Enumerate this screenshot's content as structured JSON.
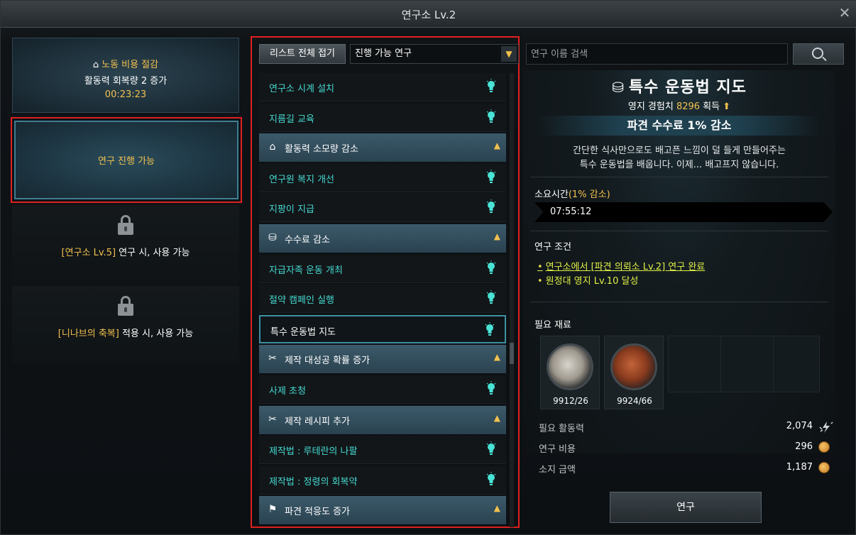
{
  "window": {
    "title": "연구소 Lv.2",
    "close_label": "✕"
  },
  "left": {
    "bonus": {
      "title": "노동 비용 절감",
      "desc": "활동력 회복량 2 증가",
      "time": "00:23:23"
    },
    "active_slot": {
      "label": "연구 진행 가능"
    },
    "locked_slots": [
      {
        "highlight": "[연구소 Lv.5]",
        "text": " 연구 시, 사용 가능"
      },
      {
        "highlight": "[니나브의 축복]",
        "text": " 적용 시, 사용 가능"
      }
    ]
  },
  "middle": {
    "collapse_label": "리스트 전체 접기",
    "filter_value": "진행 가능 연구",
    "rows": [
      {
        "type": "item",
        "label": "연구소 시계 설치"
      },
      {
        "type": "item",
        "label": "지름길 교육"
      },
      {
        "type": "cat",
        "label": "활동력 소모량 감소",
        "icon": "home-down-icon"
      },
      {
        "type": "item",
        "label": "연구원 복지 개선"
      },
      {
        "type": "item",
        "label": "지팡이 지급"
      },
      {
        "type": "cat",
        "label": "수수료 감소",
        "icon": "coin-down-icon"
      },
      {
        "type": "item",
        "label": "자급자족 운동 개최"
      },
      {
        "type": "item",
        "label": "절약 캠페인 실행"
      },
      {
        "type": "item",
        "label": "특수 운동법 지도",
        "selected": true
      },
      {
        "type": "cat",
        "label": "제작 대성공 확률 증가",
        "icon": "tools-up-icon"
      },
      {
        "type": "item",
        "label": "사제 초청"
      },
      {
        "type": "cat",
        "label": "제작 레시피 추가",
        "icon": "tools-icon"
      },
      {
        "type": "item",
        "label": "제작법 : 루테란의 나팔"
      },
      {
        "type": "item",
        "label": "제작법 : 정령의 회복약"
      },
      {
        "type": "cat",
        "label": "파견 적응도 증가",
        "icon": "flag-up-icon"
      }
    ]
  },
  "right": {
    "search_placeholder": "연구 이름 검색",
    "detail": {
      "title": "특수 운동법 지도",
      "exp_prefix": "영지 경험치 ",
      "exp_value": "8296",
      "exp_suffix": " 획득",
      "effect": "파견 수수료 1% 감소",
      "desc": "간단한 식사만으로도 배고픈 느낌이 덜 들게 만들어주는\n특수 운동법을 배웁니다. 이제... 배고프지 않습니다.",
      "time_label": "소요시간",
      "time_sub": "(1% 감소)",
      "time_value": "07:55:12",
      "cond_label": "연구 조건",
      "cond_1": "연구소에서 [파견 의뢰소 Lv.2] 연구 완료",
      "cond_2": "원정대 영지 Lv.10 달성",
      "mat_label": "필요 재료",
      "materials": [
        {
          "name": "ore",
          "qty": "9912/26"
        },
        {
          "name": "timber",
          "qty": "9924/66"
        }
      ],
      "costs": [
        {
          "label": "필요 활동력",
          "value": "2,074",
          "icon": "energy-icon"
        },
        {
          "label": "연구 비용",
          "value": "296",
          "icon": "gold-coin-icon"
        },
        {
          "label": "소지 금액",
          "value": "1,187",
          "icon": "gold-coin-icon"
        }
      ],
      "research_label": "연구"
    }
  },
  "colors": {
    "accent_gold": "#f2c14e",
    "item_cyan": "#45d9d0",
    "condition_yellow": "#e0f046",
    "highlight_red": "#e02020"
  }
}
